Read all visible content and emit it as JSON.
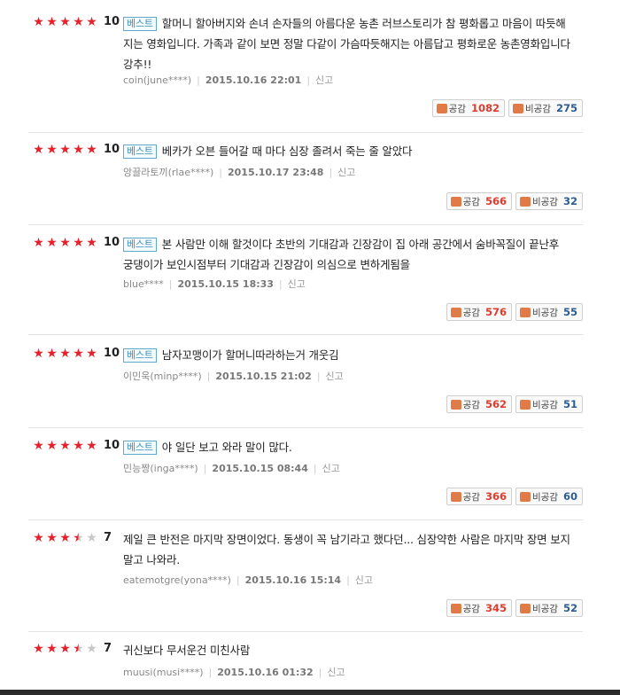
{
  "reviews": [
    {
      "stars": [
        "full",
        "full",
        "full",
        "full",
        "full"
      ],
      "score": "10",
      "best": "베스트",
      "text": "할머니 할아버지와 손녀 손자들의 아름다운 농촌 러브스토리가 참 평화롭고 마음이 따듯해지는 영화입니다. 가족과 같이 보면 정말 다같이 가슴따듯해지는 아름답고 평화로운 농촌영화입니다 강추!!",
      "user": "coin(june****)",
      "date": "2015.10.16 22:01",
      "report": "신고",
      "like_label": "공감",
      "like_count": "1082",
      "dislike_label": "비공감",
      "dislike_count": "275"
    },
    {
      "stars": [
        "full",
        "full",
        "full",
        "full",
        "full"
      ],
      "score": "10",
      "best": "베스트",
      "text": "베카가 오븐 들어갈 때 마다 심장 졸려서 죽는 줄 알았다",
      "user": "앙끌라토끼(rlae****)",
      "date": "2015.10.17 23:48",
      "report": "신고",
      "like_label": "공감",
      "like_count": "566",
      "dislike_label": "비공감",
      "dislike_count": "32"
    },
    {
      "stars": [
        "full",
        "full",
        "full",
        "full",
        "full"
      ],
      "score": "10",
      "best": "베스트",
      "text": "본 사람만 이해 할것이다 초반의 기대감과 긴장감이 집 아래 공간에서 숨바꼭질이 끝난후 궁댕이가 보인시점부터 기대감과 긴장감이 의심으로 변하게됨을",
      "user": "blue****",
      "date": "2015.10.15 18:33",
      "report": "신고",
      "like_label": "공감",
      "like_count": "576",
      "dislike_label": "비공감",
      "dislike_count": "55"
    },
    {
      "stars": [
        "full",
        "full",
        "full",
        "full",
        "full"
      ],
      "score": "10",
      "best": "베스트",
      "text": "남자꼬맹이가 할머니따라하는거 개웃김",
      "user": "이민욱(minp****)",
      "date": "2015.10.15 21:02",
      "report": "신고",
      "like_label": "공감",
      "like_count": "562",
      "dislike_label": "비공감",
      "dislike_count": "51"
    },
    {
      "stars": [
        "full",
        "full",
        "full",
        "full",
        "full"
      ],
      "score": "10",
      "best": "베스트",
      "text": "야 일단 보고 와라 말이 많다.",
      "user": "민능짱(inga****)",
      "date": "2015.10.15 08:44",
      "report": "신고",
      "like_label": "공감",
      "like_count": "366",
      "dislike_label": "비공감",
      "dislike_count": "60"
    },
    {
      "stars": [
        "full",
        "full",
        "full",
        "half",
        "empty"
      ],
      "score": "7",
      "best": "",
      "text": "제일 큰 반전은 마지막 장면이었다. 동생이 꼭 남기라고 했다던... 심장약한 사람은 마지막 장면 보지말고 나와라.",
      "user": "eatemotgre(yona****)",
      "date": "2015.10.16 15:14",
      "report": "신고",
      "like_label": "공감",
      "like_count": "345",
      "dislike_label": "비공감",
      "dislike_count": "52"
    },
    {
      "stars": [
        "full",
        "full",
        "full",
        "half",
        "empty"
      ],
      "score": "7",
      "best": "",
      "text": "귀신보다 무서운건 미친사람",
      "user": "muusi(musi****)",
      "date": "2015.10.16 01:32",
      "report": "신고",
      "like_label": "",
      "like_count": "",
      "dislike_label": "",
      "dislike_count": ""
    }
  ],
  "colors": {
    "star": "#e8202b",
    "like_count": "#e23a2b",
    "dislike_count": "#2b5d93",
    "badge": "#3d8fb3"
  }
}
